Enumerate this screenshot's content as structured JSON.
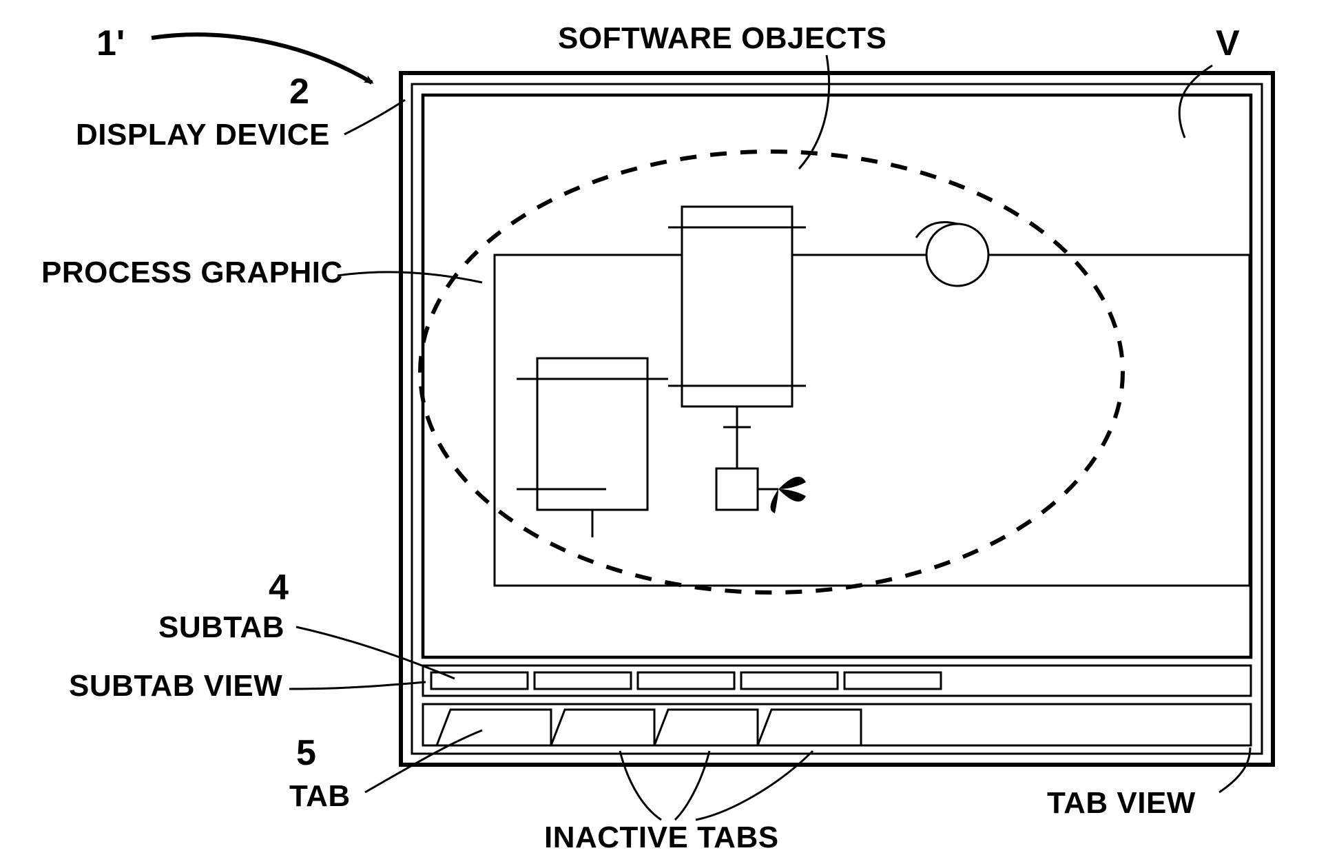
{
  "labels": {
    "one_prime": "1'",
    "software_objects": "SOFTWARE OBJECTS",
    "v": "V",
    "two": "2",
    "display_device": "DISPLAY DEVICE",
    "process_graphic": "PROCESS GRAPHIC",
    "four": "4",
    "subtab": "SUBTAB",
    "subtab_view": "SUBTAB VIEW",
    "five": "5",
    "tab": "TAB",
    "inactive_tabs": "INACTIVE TABS",
    "tab_view": "TAB VIEW"
  }
}
